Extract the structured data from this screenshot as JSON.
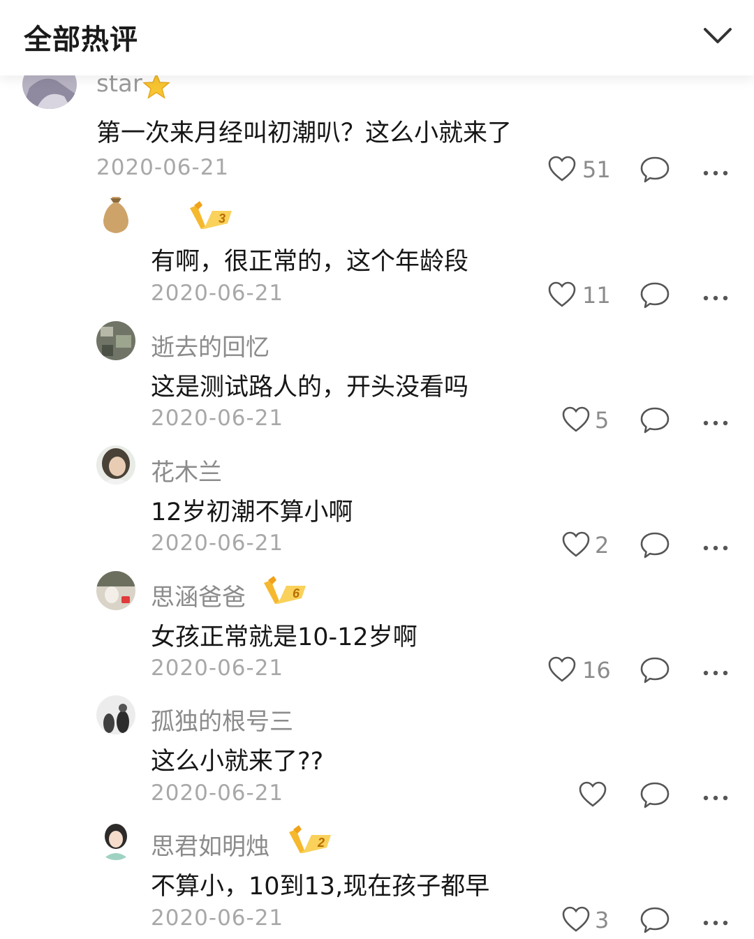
{
  "header": {
    "title": "全部热评"
  },
  "top_comment": {
    "username": "star",
    "text": "第一次来月经叫初潮叭？这么小就来了",
    "date": "2020-06-21",
    "likes": "51"
  },
  "comments": [
    {
      "username": "",
      "vip_level": "3",
      "text": "有啊，很正常的，这个年龄段",
      "date": "2020-06-21",
      "likes": "11"
    },
    {
      "username": "逝去的回忆",
      "vip_level": "",
      "text": "这是测试路人的，开头没看吗",
      "date": "2020-06-21",
      "likes": "5"
    },
    {
      "username": "花木兰",
      "vip_level": "",
      "text": "12岁初潮不算小啊",
      "date": "2020-06-21",
      "likes": "2"
    },
    {
      "username": "思涵爸爸",
      "vip_level": "6",
      "text": "女孩正常就是10-12岁啊",
      "date": "2020-06-21",
      "likes": "16"
    },
    {
      "username": "孤独的根号三",
      "vip_level": "",
      "text": "这么小就来了??",
      "date": "2020-06-21",
      "likes": ""
    },
    {
      "username": "思君如明烛",
      "vip_level": "2",
      "text": "不算小，10到13,现在孩子都早",
      "date": "2020-06-21",
      "likes": "3"
    }
  ],
  "icons": {
    "like": "heart-outline-icon",
    "reply": "speech-bubble-icon",
    "more": "ellipsis-icon",
    "collapse": "chevron-down-icon",
    "star": "star-icon"
  },
  "colors": {
    "text_primary": "#161616",
    "text_secondary": "#8b8b8b",
    "date": "#a8a8a8",
    "vip_gold": "#f5b82e"
  }
}
